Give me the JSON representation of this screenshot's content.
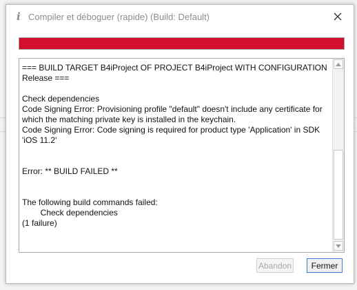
{
  "window": {
    "title_icon": "i",
    "title": "Compiler et déboguer (rapide) (Build: Default)",
    "close_icon": "close-icon"
  },
  "progress": {
    "value": 1.0,
    "color": "#d2102c"
  },
  "log": {
    "text": "=== BUILD TARGET B4iProject OF PROJECT B4iProject WITH CONFIGURATION Release ===\n\nCheck dependencies\nCode Signing Error: Provisioning profile \"default\" doesn't include any certificate for which the matching private key is installed in the keychain.\nCode Signing Error: Code signing is required for product type 'Application' in SDK 'iOS 11.2'\n\n\nError: ** BUILD FAILED **\n\n\nThe following build commands failed:\n\tCheck dependencies\n(1 failure)"
  },
  "buttons": {
    "abandon": "Abandon",
    "close": "Fermer"
  }
}
